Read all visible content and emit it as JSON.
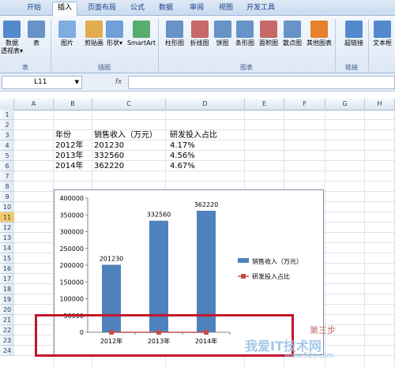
{
  "ribbon": {
    "tabs": [
      "开始",
      "插入",
      "页面布局",
      "公式",
      "数据",
      "审阅",
      "视图",
      "开发工具"
    ],
    "active_tab": "插入",
    "buttons": [
      {
        "label": "数据\n透视表▾",
        "icon": "pivot-table-icon",
        "color": "#3a75c4"
      },
      {
        "label": "表",
        "icon": "table-icon",
        "color": "#4f81bd"
      },
      {
        "label": "图片",
        "icon": "picture-icon",
        "color": "#6aa0d8"
      },
      {
        "label": "剪贴画",
        "icon": "clip-art-icon",
        "color": "#e0a030"
      },
      {
        "label": "形状▾",
        "icon": "shapes-icon",
        "color": "#5b8fd0"
      },
      {
        "label": "SmartArt",
        "icon": "smartart-icon",
        "color": "#3ca053"
      },
      {
        "label": "柱形图",
        "icon": "column-chart-icon",
        "color": "#4f81bd"
      },
      {
        "label": "折线图",
        "icon": "line-chart-icon",
        "color": "#c0504d"
      },
      {
        "label": "饼图",
        "icon": "pie-chart-icon",
        "color": "#4f81bd"
      },
      {
        "label": "条形图",
        "icon": "bar-chart-icon",
        "color": "#4f81bd"
      },
      {
        "label": "面积图",
        "icon": "area-chart-icon",
        "color": "#c0504d"
      },
      {
        "label": "散点图",
        "icon": "scatter-chart-icon",
        "color": "#4f81bd"
      },
      {
        "label": "其他图表",
        "icon": "other-charts-icon",
        "color": "#e46c0a"
      },
      {
        "label": "超链接",
        "icon": "hyperlink-icon",
        "color": "#3a75c4"
      },
      {
        "label": "文本框",
        "icon": "textbox-icon",
        "color": "#3a75c4"
      }
    ],
    "groups": [
      "表",
      "插图",
      "图表",
      "链接"
    ]
  },
  "formula_bar": {
    "name_box": "L11",
    "fx": "fx",
    "formula": ""
  },
  "sheet": {
    "columns": [
      "A",
      "B",
      "C",
      "D",
      "E",
      "F",
      "G",
      "H"
    ],
    "rows": [
      "1",
      "2",
      "3",
      "4",
      "5",
      "6",
      "7",
      "8",
      "9",
      "10",
      "11",
      "12",
      "13",
      "14",
      "15",
      "16",
      "17",
      "18",
      "19",
      "20",
      "21",
      "22",
      "23",
      "24"
    ],
    "selected_row": "11",
    "cells": {
      "b3": "年份",
      "c3": "销售收入（万元）",
      "d3": "研发投入占比",
      "b4": "2012年",
      "c4": "201230",
      "d4": "4.17%",
      "b5": "2013年",
      "c5": "332560",
      "d5": "4.56%",
      "b6": "2014年",
      "c6": "362220",
      "d6": "4.67%"
    }
  },
  "chart_data": {
    "type": "bar",
    "categories": [
      "2012年",
      "2013年",
      "2014年"
    ],
    "series": [
      {
        "name": "销售收入（万元）",
        "values": [
          201230,
          332560,
          362220
        ],
        "color": "#4f81bd"
      },
      {
        "name": "研发投入占比",
        "values": [
          4.17,
          4.56,
          4.67
        ],
        "color": "#c0504d"
      }
    ],
    "data_labels": [
      "201230",
      "332560",
      "362220"
    ],
    "yticks": [
      "400000",
      "350000",
      "300000",
      "250000",
      "200000",
      "150000",
      "100000",
      "50000",
      "0"
    ],
    "ylim": [
      0,
      400000
    ],
    "legend_position": "right"
  },
  "watermark": {
    "text": "我爱IT技术网",
    "url": "www.52ij.com",
    "stamp": "第三步"
  },
  "colors": {
    "highlight_box": "#c2152b",
    "selected_row": "#f7c86a"
  }
}
